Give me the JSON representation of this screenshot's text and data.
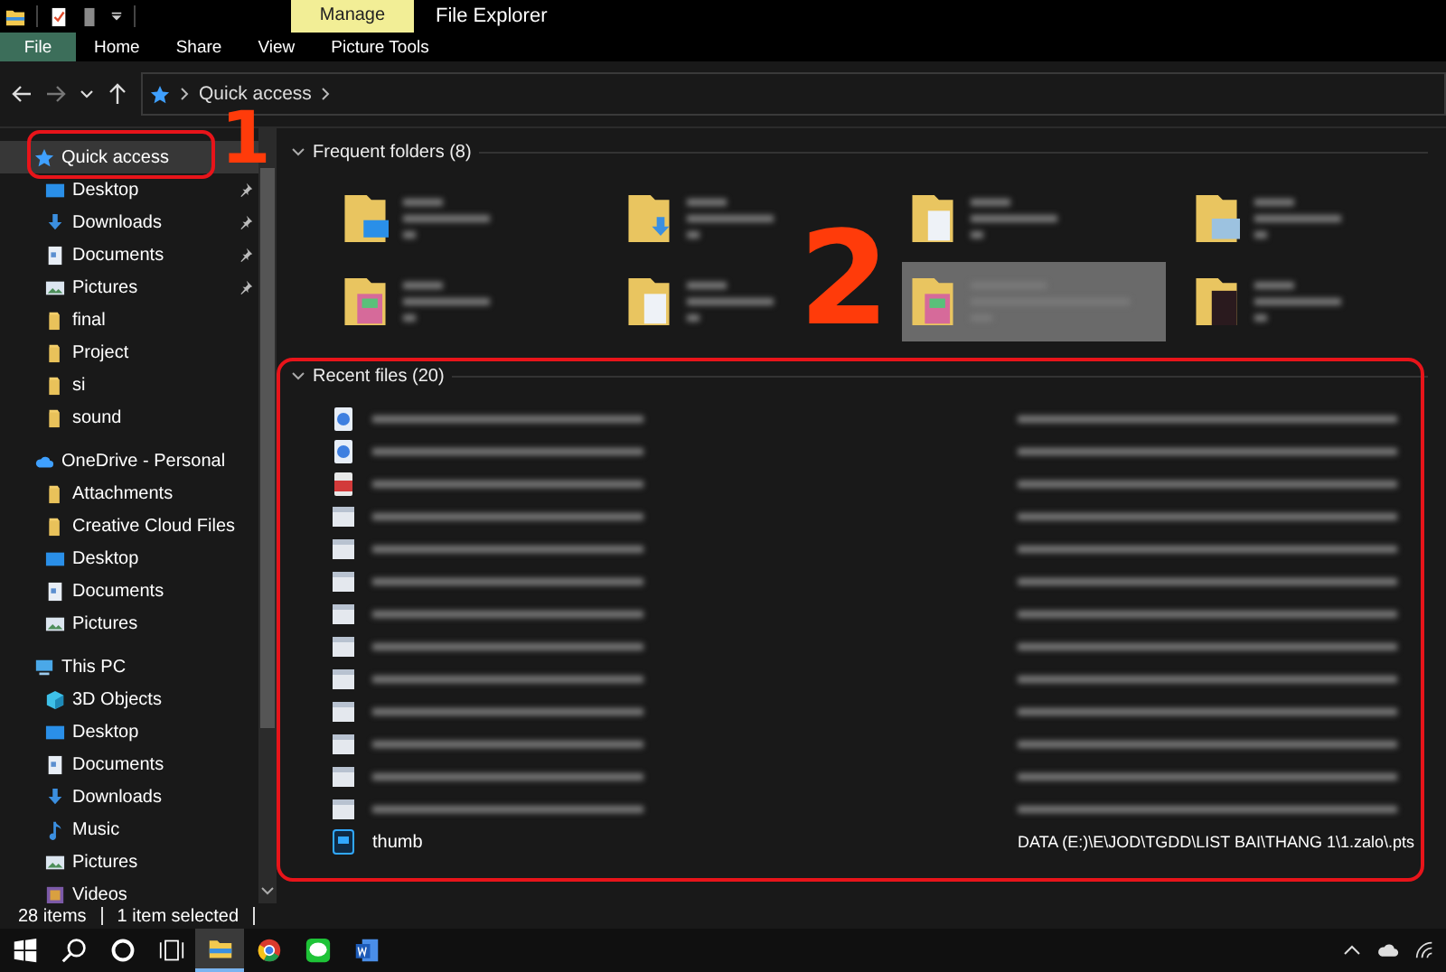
{
  "title_bar": {
    "context_tab": "Manage",
    "title": "File Explorer"
  },
  "ribbon_tabs": [
    {
      "label": "File",
      "kind": "file"
    },
    {
      "label": "Home",
      "kind": "tab"
    },
    {
      "label": "Share",
      "kind": "tab"
    },
    {
      "label": "View",
      "kind": "tab"
    },
    {
      "label": "Picture Tools",
      "kind": "tab"
    }
  ],
  "address_bar": {
    "path": [
      "Quick access"
    ]
  },
  "nav_pane": [
    {
      "label": "Quick access",
      "kind": "star",
      "selected": true,
      "children": [
        {
          "label": "Desktop",
          "kind": "desktop",
          "pinned": true,
          "selected": false
        },
        {
          "label": "Downloads",
          "kind": "download",
          "pinned": true,
          "selected": false
        },
        {
          "label": "Documents",
          "kind": "document",
          "pinned": true,
          "selected": false
        },
        {
          "label": "Pictures",
          "kind": "pictures",
          "pinned": true,
          "selected": false
        },
        {
          "label": "final",
          "kind": "folder",
          "pinned": false,
          "selected": false
        },
        {
          "label": "Project",
          "kind": "folder",
          "pinned": false,
          "selected": false
        },
        {
          "label": "si",
          "kind": "folder",
          "pinned": false,
          "selected": false
        },
        {
          "label": "sound",
          "kind": "folder",
          "pinned": false,
          "selected": false
        }
      ]
    },
    {
      "label": "OneDrive - Personal",
      "kind": "cloud",
      "selected": false,
      "children": [
        {
          "label": "Attachments",
          "kind": "folder",
          "pinned": false,
          "selected": false
        },
        {
          "label": "Creative Cloud Files",
          "kind": "folder",
          "pinned": false,
          "selected": false
        },
        {
          "label": "Desktop",
          "kind": "desktop",
          "pinned": false,
          "selected": false
        },
        {
          "label": "Documents",
          "kind": "document",
          "pinned": false,
          "selected": false
        },
        {
          "label": "Pictures",
          "kind": "pictures",
          "pinned": false,
          "selected": false
        }
      ]
    },
    {
      "label": "This PC",
      "kind": "pc",
      "selected": false,
      "children": [
        {
          "label": "3D Objects",
          "kind": "cube",
          "pinned": false,
          "selected": false
        },
        {
          "label": "Desktop",
          "kind": "desktop",
          "pinned": false,
          "selected": false
        },
        {
          "label": "Documents",
          "kind": "document",
          "pinned": false,
          "selected": false
        },
        {
          "label": "Downloads",
          "kind": "download",
          "pinned": false,
          "selected": false
        },
        {
          "label": "Music",
          "kind": "music",
          "pinned": false,
          "selected": false
        },
        {
          "label": "Pictures",
          "kind": "pictures",
          "pinned": false,
          "selected": false
        },
        {
          "label": "Videos",
          "kind": "videos",
          "pinned": false,
          "selected": false
        }
      ]
    }
  ],
  "frequent_folders": {
    "title": "Frequent folders (8)",
    "items": [
      {
        "kind": "desktop",
        "selected": false
      },
      {
        "kind": "download",
        "selected": false
      },
      {
        "kind": "document",
        "selected": false
      },
      {
        "kind": "pictures",
        "selected": false
      },
      {
        "kind": "colorful",
        "selected": false
      },
      {
        "kind": "document",
        "selected": false
      },
      {
        "kind": "colorful",
        "selected": true
      },
      {
        "kind": "dark",
        "selected": false
      }
    ]
  },
  "recent_files": {
    "title": "Recent files (20)",
    "items": [
      {
        "kind": "word",
        "blurred": true
      },
      {
        "kind": "word",
        "blurred": true
      },
      {
        "kind": "pdf",
        "blurred": true
      },
      {
        "kind": "image",
        "blurred": true
      },
      {
        "kind": "image",
        "blurred": true
      },
      {
        "kind": "image",
        "blurred": true
      },
      {
        "kind": "image",
        "blurred": true
      },
      {
        "kind": "image",
        "blurred": true
      },
      {
        "kind": "image",
        "blurred": true
      },
      {
        "kind": "image",
        "blurred": true
      },
      {
        "kind": "image",
        "blurred": true
      },
      {
        "kind": "image",
        "blurred": true
      },
      {
        "kind": "image",
        "blurred": true
      },
      {
        "kind": "photoshop",
        "blurred": false,
        "name": "thumb",
        "path": "DATA (E:)\\E\\JOD\\TGDD\\LIST BAI\\THANG 1\\1.zalo\\.pts"
      }
    ]
  },
  "status_bar": {
    "item_count": "28 items",
    "selection": "1 item selected"
  },
  "taskbar": [
    {
      "kind": "start",
      "active": false
    },
    {
      "kind": "search",
      "active": false
    },
    {
      "kind": "cortana",
      "active": false
    },
    {
      "kind": "task-view",
      "active": false
    },
    {
      "kind": "explorer",
      "active": true
    },
    {
      "kind": "chrome",
      "active": false
    },
    {
      "kind": "line",
      "active": false
    },
    {
      "kind": "word",
      "active": false
    }
  ],
  "annotations": [
    {
      "label": "1"
    },
    {
      "label": "2"
    }
  ]
}
